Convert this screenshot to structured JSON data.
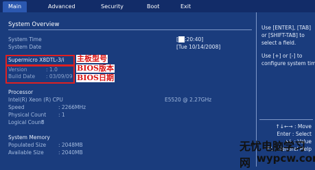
{
  "tabs": [
    "Main",
    "Advanced",
    "Security",
    "Boot",
    "Exit"
  ],
  "overview": {
    "title": "System Overview",
    "system_time_label": "System Time",
    "system_time_value": "[",
    "system_time_value2": ":20:40]",
    "system_date_label": "System Date",
    "system_date_value": "[Tue 10/14/2008]"
  },
  "board": {
    "model": "Supermicro X8DTL-3/i",
    "version_label": "Version",
    "version_value": ": 1.0",
    "build_label": "Build Date",
    "build_value": ": 03/09/09",
    "annotations": [
      "主板型号",
      "BIOS版本",
      "BIOS日期"
    ]
  },
  "processor": {
    "title": "Processor",
    "name": "Intel(R) Xeon (R) CPU",
    "model": "E5520 @ 2.27GHz",
    "speed_label": "Speed",
    "speed_value": ": 2266MHz",
    "physical_label": "Physical Count",
    "physical_value": ": 1",
    "logical_label": "Logical Count",
    "logical_value": ": 8"
  },
  "memory": {
    "title": "System Memory",
    "populated_label": "Populated Size",
    "populated_value": ": 2048MB",
    "available_label": "Available Size",
    "available_value": ": 2040MB"
  },
  "help": {
    "line1": "Use [ENTER], [TAB]",
    "line2": "or [SHIFT-TAB] to",
    "line3": "select a field.",
    "line4": "Use [+] or [-] to",
    "line5": "configure system time.",
    "key1": "↑↓←→ : Move",
    "key2": "Enter : Select",
    "key3": "+/- : Value",
    "key4": "F1 : General Help"
  },
  "watermark": {
    "title": "无忧电脑学习网",
    "url": "wypcw.com"
  }
}
